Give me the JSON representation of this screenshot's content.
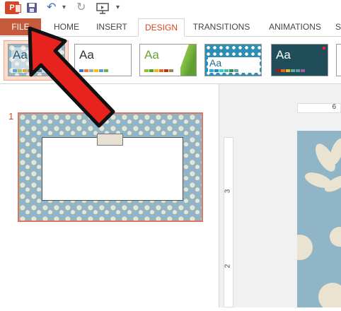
{
  "qat": {
    "logo_letter": "P",
    "undo_glyph": "↶",
    "undo_dropdown_glyph": "▾",
    "redo_glyph": "↻",
    "more_glyph": "▾",
    "icons": [
      "powerpoint-logo-icon",
      "save-icon",
      "undo-icon",
      "redo-icon",
      "start-from-beginning-icon",
      "customize-qat-icon"
    ]
  },
  "tabs": [
    {
      "label": "FILE"
    },
    {
      "label": "HOME"
    },
    {
      "label": "INSERT"
    },
    {
      "label": "DESIGN",
      "active": true
    },
    {
      "label": "TRANSITIONS"
    },
    {
      "label": "ANIMATIONS"
    },
    {
      "label": "S"
    }
  ],
  "themes": [
    {
      "label": "Aa",
      "selected": true
    },
    {
      "label": "Aa"
    },
    {
      "label": "Aa"
    },
    {
      "label": "Aa"
    },
    {
      "label": "Aa"
    }
  ],
  "colors": {
    "accent": "#d24726",
    "file_tab": "#c55a3c",
    "arrow_fill": "#e8231f",
    "pattern_teal": "#8fb5c6",
    "pattern_cream": "#eae3d0"
  },
  "slides": {
    "current_number": "1"
  },
  "ruler": {
    "top_label": "6",
    "left_labels": [
      "3",
      "2"
    ]
  }
}
